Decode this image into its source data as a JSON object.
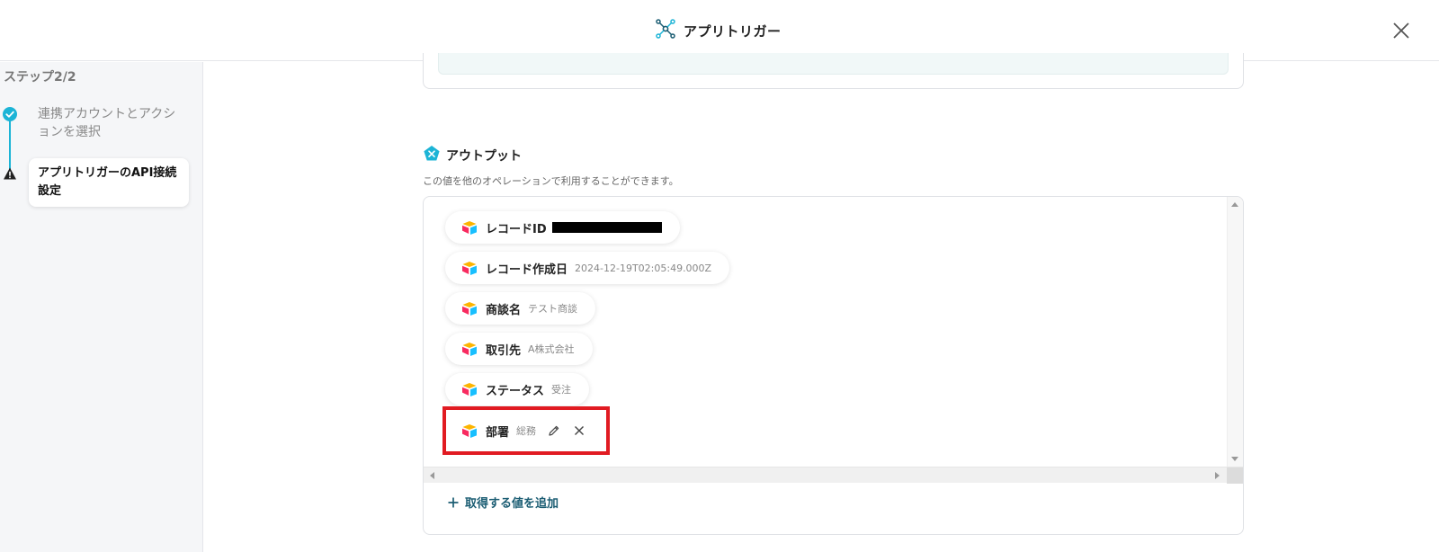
{
  "header": {
    "title": "アプリトリガー",
    "icon": "app-trigger-icon"
  },
  "sidebar": {
    "step_counter": "ステップ2/2",
    "steps": [
      {
        "label": "連携アカウントとアクションを選択",
        "status": "complete"
      },
      {
        "label": "アプリトリガーのAPI接続設定",
        "status": "warning"
      }
    ]
  },
  "output": {
    "heading": "アウトプット",
    "description": "この値を他のオペレーションで利用することができます。",
    "items": [
      {
        "label": "レコードID",
        "value": ""
      },
      {
        "label": "レコード作成日",
        "value": "2024-12-19T02:05:49.000Z"
      },
      {
        "label": "商談名",
        "value": "テスト商談"
      },
      {
        "label": "取引先",
        "value": "A株式会社"
      },
      {
        "label": "ステータス",
        "value": "受注"
      },
      {
        "label": "部署",
        "value": "総務"
      }
    ],
    "add_label": "取得する値を追加"
  },
  "colors": {
    "accent": "#1cb4d6",
    "highlight": "#e11b22",
    "link": "#1b5d73"
  }
}
